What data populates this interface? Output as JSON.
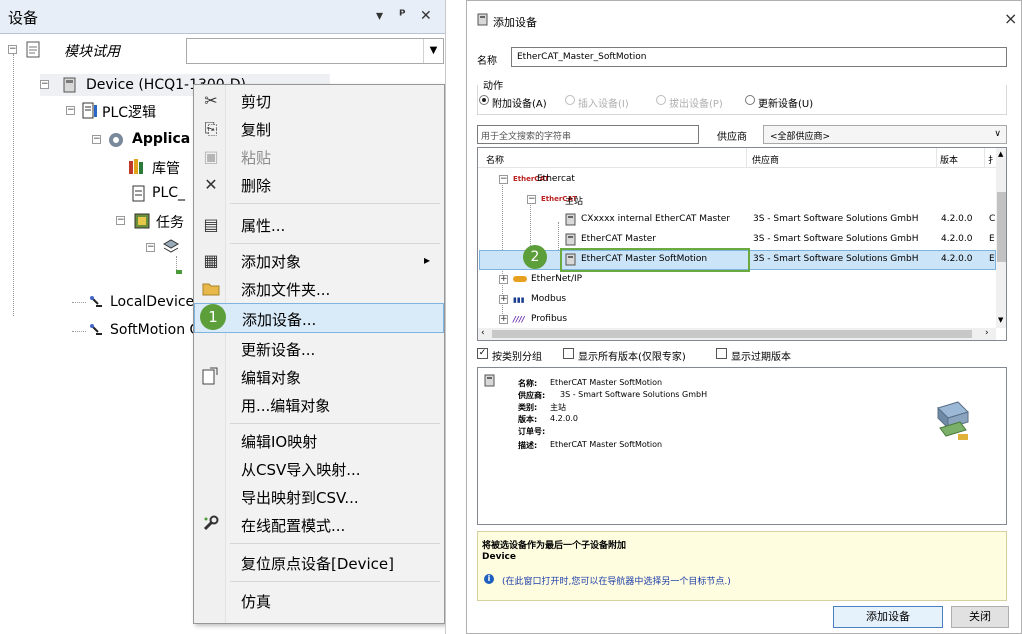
{
  "left_panel": {
    "title": "设备",
    "ctl_dropdown": "▾",
    "ctl_pin": "ᵖ",
    "ctl_close": "✕",
    "project_name": "模块试用",
    "tree": {
      "device": "Device (HCQ1-1300-D)",
      "plc_logic": "PLC逻辑",
      "application": "Applica",
      "library": "库管",
      "plc_prg": "PLC_",
      "tasks": "任务",
      "local_device": "LocalDevice",
      "softmotion": "SoftMotion G"
    }
  },
  "context_menu": {
    "items": [
      {
        "label": "剪切",
        "icon": "scissors-icon",
        "glyph": "✂",
        "disabled": false
      },
      {
        "label": "复制",
        "icon": "copy-icon",
        "glyph": "⎘",
        "disabled": false
      },
      {
        "label": "粘贴",
        "icon": "paste-icon",
        "glyph": "📋",
        "disabled": true
      },
      {
        "label": "删除",
        "icon": "delete-icon",
        "glyph": "✕",
        "disabled": false
      },
      {
        "label": "属性...",
        "icon": "properties-icon",
        "glyph": "▤",
        "disabled": false
      },
      {
        "label": "添加对象",
        "icon": "add-object-icon",
        "glyph": "▦",
        "disabled": false,
        "submenu": true
      },
      {
        "label": "添加文件夹...",
        "icon": "folder-icon",
        "glyph": "▬",
        "disabled": false
      },
      {
        "label": "添加设备...",
        "icon": "",
        "glyph": "",
        "disabled": false,
        "highlighted": true
      },
      {
        "label": "更新设备...",
        "icon": "",
        "glyph": "",
        "disabled": false
      },
      {
        "label": "编辑对象",
        "icon": "edit-object-icon",
        "glyph": "↗",
        "disabled": false
      },
      {
        "label": "用...编辑对象",
        "icon": "",
        "glyph": "",
        "disabled": false
      },
      {
        "label": "编辑IO映射",
        "icon": "",
        "glyph": "",
        "disabled": false
      },
      {
        "label": "从CSV导入映射...",
        "icon": "",
        "glyph": "",
        "disabled": false
      },
      {
        "label": "导出映射到CSV...",
        "icon": "",
        "glyph": "",
        "disabled": false
      },
      {
        "label": "在线配置模式...",
        "icon": "wrench-icon",
        "glyph": "🔧",
        "disabled": false
      },
      {
        "label": "复位原点设备[Device]",
        "icon": "",
        "glyph": "",
        "disabled": false
      },
      {
        "label": "仿真",
        "icon": "",
        "glyph": "",
        "disabled": false
      }
    ],
    "submenu_arrow": "▸",
    "step_badge": "1"
  },
  "dialog": {
    "title": "添加设备",
    "close_glyph": "×",
    "name_label": "名称",
    "name_value": "EtherCAT_Master_SoftMotion",
    "action_label": "动作",
    "actions": [
      {
        "label": "附加设备(A)",
        "selected": true,
        "disabled": false
      },
      {
        "label": "插入设备(I)",
        "selected": false,
        "disabled": true
      },
      {
        "label": "拔出设备(P)",
        "selected": false,
        "disabled": true
      },
      {
        "label": "更新设备(U)",
        "selected": false,
        "disabled": false
      }
    ],
    "search_placeholder": "用于全文搜索的字符串",
    "vendor_label": "供应商",
    "vendor_value": "<全部供应商>",
    "columns": [
      "名称",
      "供应商",
      "版本",
      "扌"
    ],
    "rows": [
      {
        "name": "Ethercat",
        "vendor": "",
        "version": "",
        "extra": ""
      },
      {
        "name": "主站",
        "vendor": "",
        "version": "",
        "extra": ""
      },
      {
        "name": "CXxxxx internal EtherCAT Master",
        "vendor": "3S - Smart Software Solutions GmbH",
        "version": "4.2.0.0",
        "extra": "C"
      },
      {
        "name": "EtherCAT Master",
        "vendor": "3S - Smart Software Solutions GmbH",
        "version": "4.2.0.0",
        "extra": "E"
      },
      {
        "name": "EtherCAT Master SoftMotion",
        "vendor": "3S - Smart Software Solutions GmbH",
        "version": "4.2.0.0",
        "extra": "E"
      },
      {
        "name": "EtherNet/IP",
        "vendor": "",
        "version": "",
        "extra": ""
      },
      {
        "name": "Modbus",
        "vendor": "",
        "version": "",
        "extra": ""
      },
      {
        "name": "Profibus",
        "vendor": "",
        "version": "",
        "extra": ""
      }
    ],
    "step_badge": "2",
    "options": [
      {
        "label": "按类别分组",
        "checked": true
      },
      {
        "label": "显示所有版本(仅限专家)",
        "checked": false
      },
      {
        "label": "显示过期版本",
        "checked": false
      }
    ],
    "info": {
      "name_key": "名称:",
      "name_val": "EtherCAT Master SoftMotion",
      "vendor_key": "供应商:",
      "vendor_val": "3S - Smart Software Solutions GmbH",
      "category_key": "类别:",
      "category_val": "主站",
      "version_key": "版本:",
      "version_val": "4.2.0.0",
      "order_key": "订单号:",
      "order_val": "",
      "desc_key": "描述:",
      "desc_val": "EtherCAT Master SoftMotion"
    },
    "footer_bold": "将被选设备作为最后一个子设备附加",
    "footer_target": "Device",
    "footer_hint": "(在此窗口打开时,您可以在导航器中选择另一个目标节点.)",
    "add_button": "添加设备",
    "close_button": "关闭"
  },
  "colors": {
    "highlight_bg": "#d9ebf9",
    "badge_green": "#5c9e3a",
    "selection_bg": "#cce4f7"
  }
}
